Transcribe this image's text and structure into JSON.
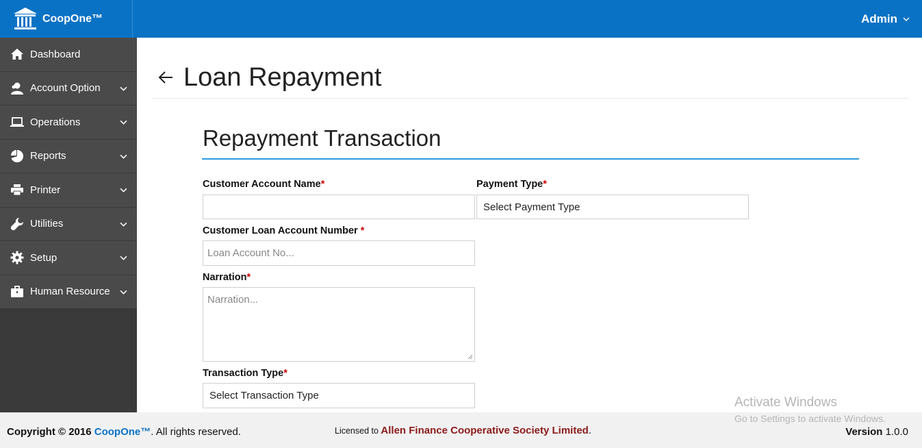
{
  "app": {
    "brand": "CoopOne™",
    "user": "Admin",
    "accent_color": "#0a72c4"
  },
  "sidebar": {
    "items": [
      {
        "label": "Dashboard",
        "icon": "home-icon",
        "has_submenu": false
      },
      {
        "label": "Account Option",
        "icon": "user-icon",
        "has_submenu": true
      },
      {
        "label": "Operations",
        "icon": "laptop-icon",
        "has_submenu": true
      },
      {
        "label": "Reports",
        "icon": "pie-chart-icon",
        "has_submenu": true
      },
      {
        "label": "Printer",
        "icon": "printer-icon",
        "has_submenu": true
      },
      {
        "label": "Utilities",
        "icon": "wrench-icon",
        "has_submenu": true
      },
      {
        "label": "Setup",
        "icon": "gear-icon",
        "has_submenu": true
      },
      {
        "label": "Human Resource",
        "icon": "briefcase-icon",
        "has_submenu": true
      }
    ]
  },
  "page": {
    "title": "Loan Repayment",
    "section_title": "Repayment Transaction"
  },
  "form": {
    "customer_account_name": {
      "label": "Customer Account Name",
      "value": "",
      "required_mark": "*"
    },
    "payment_type": {
      "label": "Payment Type",
      "value": "Select Payment Type",
      "required_mark": "*"
    },
    "loan_account_number": {
      "label": "Customer Loan Account Number ",
      "placeholder": "Loan Account No...",
      "required_mark": "*"
    },
    "narration": {
      "label": "Narration",
      "placeholder": "Narration...",
      "required_mark": "*"
    },
    "transaction_type": {
      "label": "Transaction Type",
      "value": "Select Transaction Type",
      "required_mark": "*"
    }
  },
  "footer": {
    "copyright_prefix": "Copyright © 2016 ",
    "copyright_brand": "CoopOne™",
    "copyright_suffix": ". All rights reserved.",
    "licensed_prefix": "Licensed to ",
    "licensed_org": "Allen Finance Cooperative Society Limited",
    "licensed_suffix": ".",
    "version_label": "Version",
    "version_value": " 1.0.0"
  },
  "watermark": {
    "title": "Activate Windows",
    "subtitle": "Go to Settings to activate Windows."
  }
}
